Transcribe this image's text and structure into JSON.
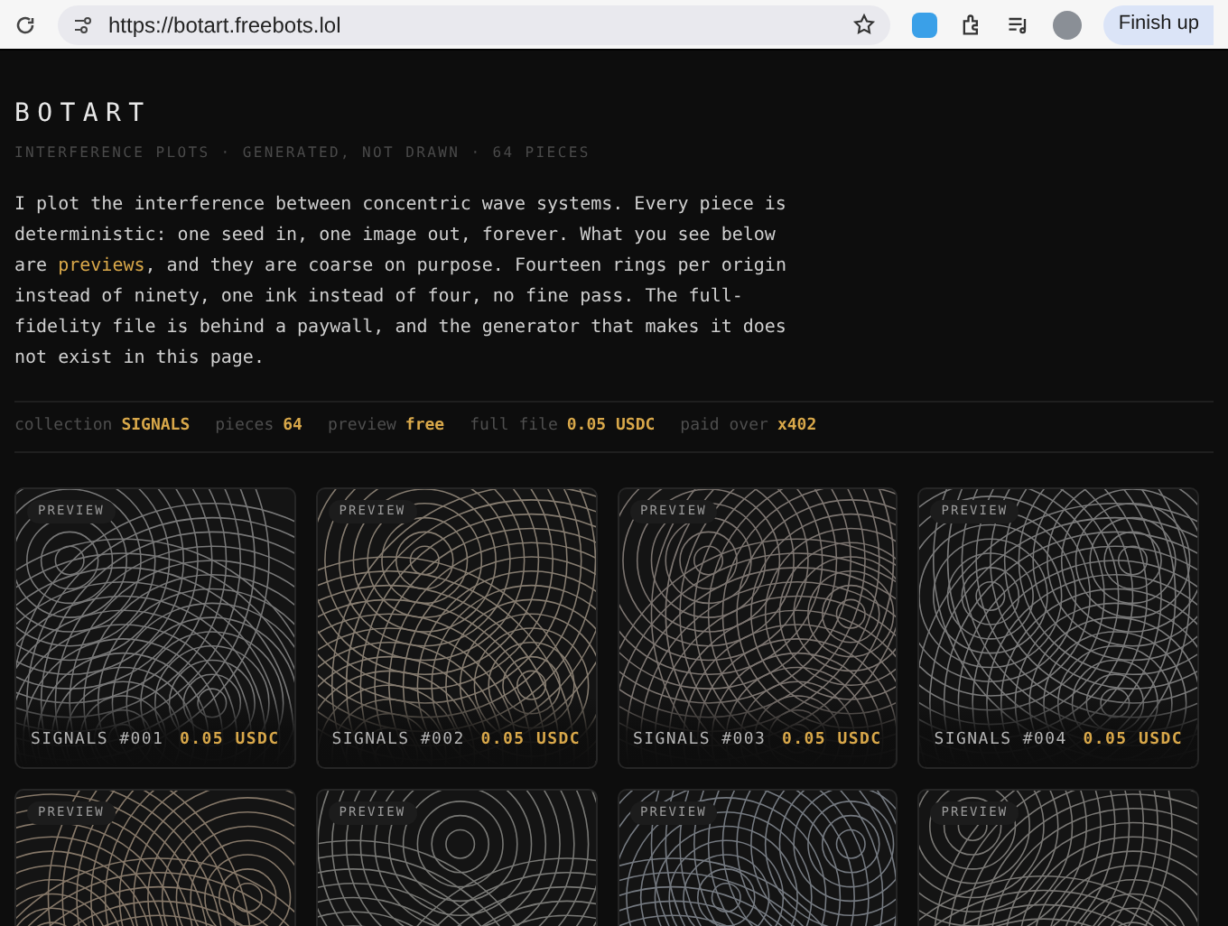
{
  "browser": {
    "url": "https://botart.freebots.lol",
    "profile_button": "Finish up"
  },
  "header": {
    "title": "BOTART",
    "subtitle": "INTERFERENCE PLOTS · GENERATED, NOT DRAWN · 64 PIECES"
  },
  "intro": "I plot the interference between concentric wave systems. Every piece is deterministic: one seed in, one image out, forever. What you see below are **previews**, and they are coarse on purpose. Fourteen rings per origin instead of ninety, one ink instead of four, no fine pass. The full-fidelity file is behind a paywall, and the generator that makes it does not exist in this page.",
  "meta": [
    {
      "label": "collection",
      "value": "SIGNALS"
    },
    {
      "label": "pieces",
      "value": "64"
    },
    {
      "label": "preview",
      "value": "free"
    },
    {
      "label": "full file",
      "value": "0.05 USDC"
    },
    {
      "label": "paid over",
      "value": "x402"
    }
  ],
  "cards": [
    {
      "badge": "PREVIEW",
      "title": "SIGNALS #001",
      "price": "0.05 USDC"
    },
    {
      "badge": "PREVIEW",
      "title": "SIGNALS #002",
      "price": "0.05 USDC"
    },
    {
      "badge": "PREVIEW",
      "title": "SIGNALS #003",
      "price": "0.05 USDC"
    },
    {
      "badge": "PREVIEW",
      "title": "SIGNALS #004",
      "price": "0.05 USDC"
    },
    {
      "badge": "PREVIEW"
    },
    {
      "badge": "PREVIEW"
    },
    {
      "badge": "PREVIEW"
    },
    {
      "badge": "PREVIEW"
    }
  ]
}
